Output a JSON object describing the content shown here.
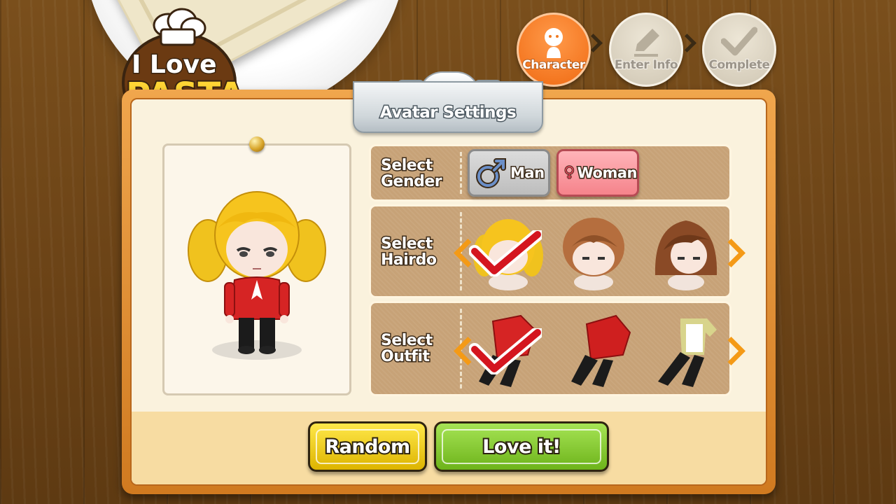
{
  "logo": {
    "line1": "I Love",
    "line2": "PASTA"
  },
  "steps": [
    {
      "label": "Character",
      "state": "active",
      "icon": "person-icon"
    },
    {
      "label": "Enter Info",
      "state": "inactive",
      "icon": "pencil-icon"
    },
    {
      "label": "Complete",
      "state": "inactive",
      "icon": "checkmark-icon"
    }
  ],
  "panel": {
    "title": "Avatar Settings"
  },
  "rows": {
    "gender": {
      "label_line1": "Select",
      "label_line2": "Gender",
      "options": [
        {
          "label": "Man",
          "icon": "male-symbol-icon"
        },
        {
          "label": "Woman",
          "icon": "female-symbol-icon"
        }
      ],
      "selected": "Woman"
    },
    "hairdo": {
      "label_line1": "Select",
      "label_line2": "Hairdo",
      "selected_index": 0
    },
    "outfit": {
      "label_line1": "Select",
      "label_line2": "Outfit",
      "selected_index": 0
    }
  },
  "buttons": {
    "random": "Random",
    "love_it": "Love it!"
  },
  "colors": {
    "active_step": "#f07a20",
    "panel_border": "#e08a2c",
    "random_button": "#f2d020",
    "love_button": "#8ccc36",
    "woman_button": "#f58c94"
  }
}
